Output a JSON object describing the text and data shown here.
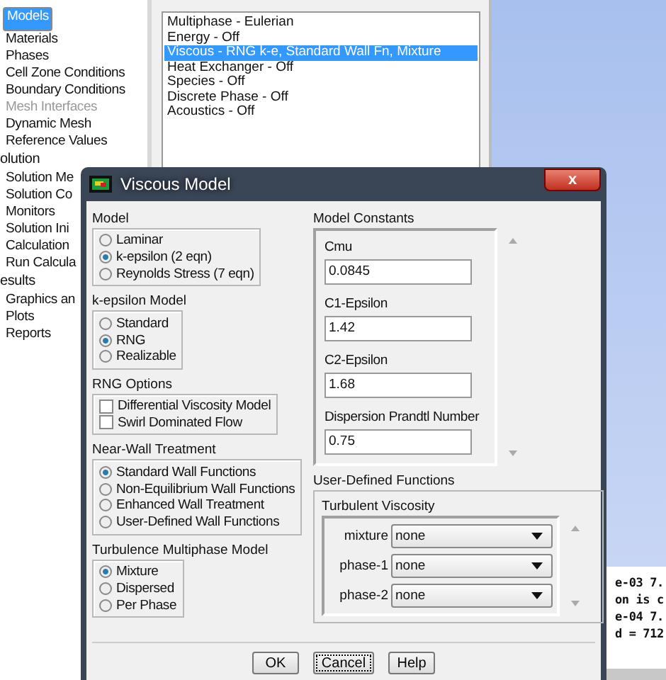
{
  "tree": [
    {
      "label": "Models",
      "kind": "item",
      "disabled": false,
      "selected": true
    },
    {
      "label": "Materials",
      "kind": "item",
      "disabled": false,
      "selected": false
    },
    {
      "label": "Phases",
      "kind": "item",
      "disabled": false,
      "selected": false
    },
    {
      "label": "Cell Zone Conditions",
      "kind": "item",
      "disabled": false,
      "selected": false
    },
    {
      "label": "Boundary Conditions",
      "kind": "item",
      "disabled": false,
      "selected": false
    },
    {
      "label": "Mesh Interfaces",
      "kind": "item",
      "disabled": true,
      "selected": false
    },
    {
      "label": "Dynamic Mesh",
      "kind": "item",
      "disabled": false,
      "selected": false
    },
    {
      "label": "Reference Values",
      "kind": "item",
      "disabled": false,
      "selected": false
    },
    {
      "label": "olution",
      "kind": "heading",
      "disabled": false,
      "selected": false
    },
    {
      "label": "Solution Me",
      "kind": "item",
      "disabled": false,
      "selected": false
    },
    {
      "label": "Solution Co",
      "kind": "item",
      "disabled": false,
      "selected": false
    },
    {
      "label": "Monitors",
      "kind": "item",
      "disabled": false,
      "selected": false
    },
    {
      "label": "Solution Ini",
      "kind": "item",
      "disabled": false,
      "selected": false
    },
    {
      "label": "Calculation",
      "kind": "item",
      "disabled": false,
      "selected": false
    },
    {
      "label": "Run Calcula",
      "kind": "item",
      "disabled": false,
      "selected": false
    },
    {
      "label": "esults",
      "kind": "heading",
      "disabled": false,
      "selected": false
    },
    {
      "label": "Graphics an",
      "kind": "item",
      "disabled": false,
      "selected": false
    },
    {
      "label": "Plots",
      "kind": "item",
      "disabled": false,
      "selected": false
    },
    {
      "label": "Reports",
      "kind": "item",
      "disabled": false,
      "selected": false
    }
  ],
  "models_panel": {
    "items": [
      {
        "label": "Multiphase - Eulerian",
        "selected": false
      },
      {
        "label": "Energy - Off",
        "selected": false
      },
      {
        "label": "Viscous - RNG k-e, Standard Wall Fn, Mixture",
        "selected": true
      },
      {
        "label": "Heat Exchanger - Off",
        "selected": false
      },
      {
        "label": "Species - Off",
        "selected": false
      },
      {
        "label": "Discrete Phase - Off",
        "selected": false
      },
      {
        "label": "Acoustics - Off",
        "selected": false
      }
    ]
  },
  "console": [
    "e-03 7.",
    "on is c",
    "e-04 7.",
    "d = 712"
  ],
  "dialog": {
    "title": "Viscous Model",
    "close": "x",
    "groups": [
      {
        "title": "Model",
        "kind": "radio",
        "options": [
          {
            "label": "Laminar",
            "selected": false
          },
          {
            "label": "k-epsilon (2 eqn)",
            "selected": true
          },
          {
            "label": "Reynolds Stress (7 eqn)",
            "selected": false
          }
        ]
      },
      {
        "title": "k-epsilon Model",
        "kind": "radio",
        "options": [
          {
            "label": "Standard",
            "selected": false
          },
          {
            "label": "RNG",
            "selected": true
          },
          {
            "label": "Realizable",
            "selected": false
          }
        ]
      },
      {
        "title": "RNG Options",
        "kind": "check",
        "options": [
          {
            "label": "Differential Viscosity Model",
            "checked": false
          },
          {
            "label": "Swirl Dominated Flow",
            "checked": false
          }
        ]
      },
      {
        "title": "Near-Wall Treatment",
        "kind": "radio",
        "options": [
          {
            "label": "Standard Wall Functions",
            "selected": true
          },
          {
            "label": "Non-Equilibrium Wall Functions",
            "selected": false
          },
          {
            "label": "Enhanced Wall Treatment",
            "selected": false
          },
          {
            "label": "User-Defined Wall Functions",
            "selected": false
          }
        ]
      },
      {
        "title": "Turbulence Multiphase Model",
        "kind": "radio",
        "options": [
          {
            "label": "Mixture",
            "selected": true
          },
          {
            "label": "Dispersed",
            "selected": false
          },
          {
            "label": "Per Phase",
            "selected": false
          }
        ]
      }
    ],
    "constants": {
      "title": "Model Constants",
      "fields": [
        {
          "label": "Cmu",
          "value": "0.0845"
        },
        {
          "label": "C1-Epsilon",
          "value": "1.42"
        },
        {
          "label": "C2-Epsilon",
          "value": "1.68"
        },
        {
          "label": "Dispersion Prandtl Number",
          "value": "0.75"
        }
      ]
    },
    "udf": {
      "title": "User-Defined Functions",
      "subtitle": "Turbulent Viscosity",
      "rows": [
        {
          "label": "mixture",
          "value": "none"
        },
        {
          "label": "phase-1",
          "value": "none"
        },
        {
          "label": "phase-2",
          "value": "none"
        }
      ]
    },
    "buttons": [
      {
        "label": "OK",
        "focused": false
      },
      {
        "label": "Cancel",
        "focused": true
      },
      {
        "label": "Help",
        "focused": false
      }
    ]
  }
}
